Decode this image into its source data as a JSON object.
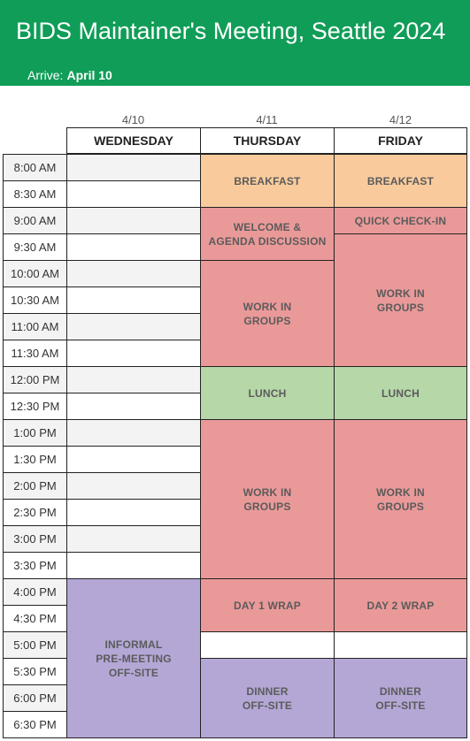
{
  "header": {
    "title": "BIDS Maintainer's Meeting, Seattle 2024",
    "arrive_label": "Arrive:",
    "arrive_date": "April 10"
  },
  "days": [
    {
      "date": "4/10",
      "name": "WEDNESDAY"
    },
    {
      "date": "4/11",
      "name": "THURSDAY"
    },
    {
      "date": "4/12",
      "name": "FRIDAY"
    }
  ],
  "times": [
    "8:00 AM",
    "8:30 AM",
    "9:00 AM",
    "9:30 AM",
    "10:00 AM",
    "10:30 AM",
    "11:00 AM",
    "11:30 AM",
    "12:00 PM",
    "12:30 PM",
    "1:00 PM",
    "1:30 PM",
    "2:00 PM",
    "2:30 PM",
    "3:00 PM",
    "3:30 PM",
    "4:00 PM",
    "4:30 PM",
    "5:00 PM",
    "5:30 PM",
    "6:00 PM",
    "6:30 PM"
  ],
  "wednesday": {
    "informal": "INFORMAL\nPRE-MEETING\nOFF-SITE"
  },
  "thursday": {
    "breakfast": "BREAKFAST",
    "welcome": "WELCOME &\nAGENDA DISCUSSION",
    "work1": "WORK IN\nGROUPS",
    "lunch": "LUNCH",
    "work2": "WORK IN\nGROUPS",
    "wrap": "DAY 1 WRAP",
    "dinner": "DINNER\nOFF-SITE"
  },
  "friday": {
    "breakfast": "BREAKFAST",
    "checkin": "QUICK CHECK-IN",
    "work1": "WORK IN\nGROUPS",
    "lunch": "LUNCH",
    "work2": "WORK IN\nGROUPS",
    "wrap": "DAY 2 WRAP",
    "dinner": "DINNER\nOFF-SITE"
  },
  "colors": {
    "header": "#109d58",
    "breakfast": "#f9cb9c",
    "work": "#ea9999",
    "lunch": "#b6d7a8",
    "offsite": "#b4a7d6"
  }
}
